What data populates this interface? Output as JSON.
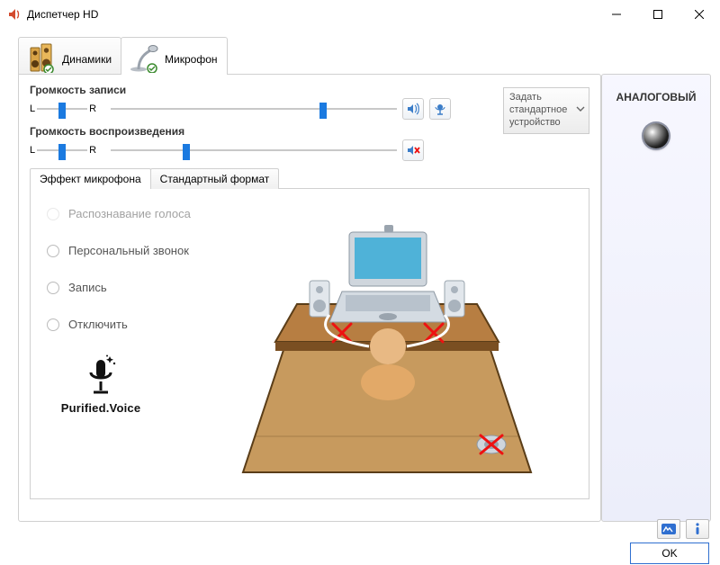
{
  "window": {
    "title": "Диспетчер HD"
  },
  "device_tabs": {
    "speakers": "Динамики",
    "mic": "Микрофон"
  },
  "sliders": {
    "record": {
      "title": "Громкость записи",
      "L": "L",
      "R": "R",
      "balance_pct": 42,
      "level_pct": 73
    },
    "playback": {
      "title": "Громкость воспроизведения",
      "L": "L",
      "R": "R",
      "balance_pct": 42,
      "level_pct": 25
    }
  },
  "default_device": "Задать стандартное устройство",
  "subtabs": {
    "effect": "Эффект микрофона",
    "format": "Стандартный формат"
  },
  "radios": {
    "voice_rec": "Распознавание голоса",
    "personal_call": "Персональный звонок",
    "record": "Запись",
    "disable": "Отключить"
  },
  "brand": {
    "name": "Purified.Voice"
  },
  "right_panel": {
    "title": "АНАЛОГОВЫЙ"
  },
  "buttons": {
    "ok": "OK"
  },
  "colors": {
    "accent": "#1b7ae0"
  }
}
